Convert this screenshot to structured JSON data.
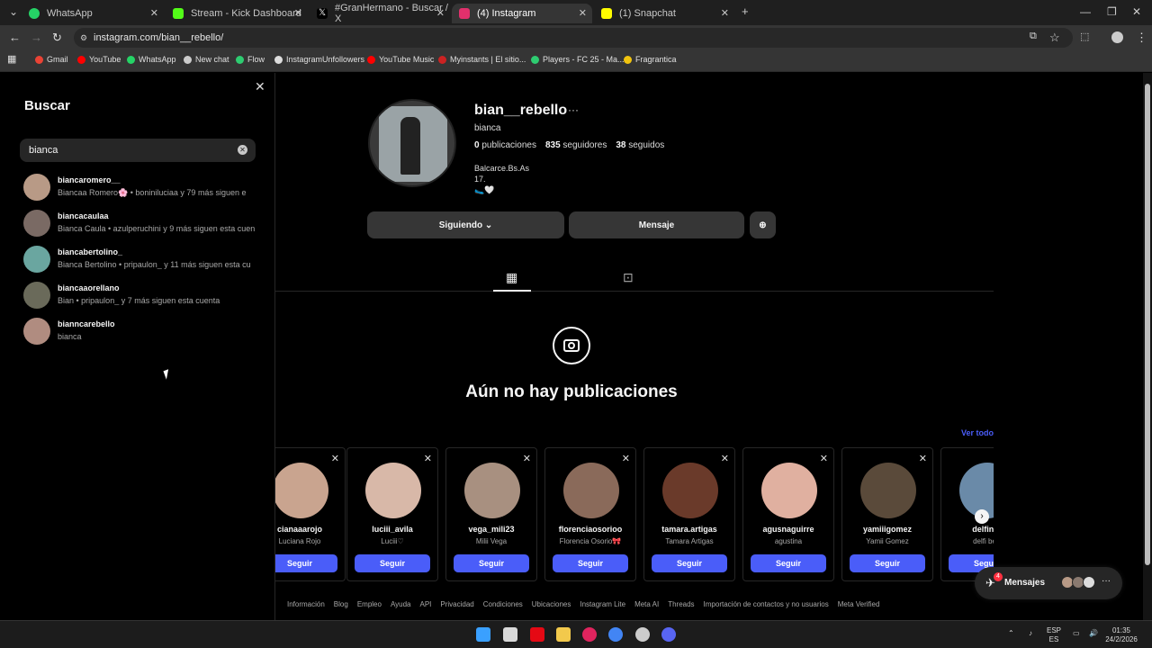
{
  "tabs": [
    {
      "label": "WhatsApp",
      "color": "#25d366"
    },
    {
      "label": "Stream - Kick Dashboard",
      "color": "#53fc18"
    },
    {
      "label": "#GranHermano - Buscar / X",
      "color": "#ffffff"
    },
    {
      "label": "(4) Instagram",
      "color": "#e1306c"
    },
    {
      "label": "(1) Snapchat",
      "color": "#fffc00"
    }
  ],
  "url": "instagram.com/bian__rebello/",
  "bookmarks": [
    {
      "label": "Gmail",
      "color": "#ea4335"
    },
    {
      "label": "YouTube",
      "color": "#ff0000"
    },
    {
      "label": "WhatsApp",
      "color": "#25d366"
    },
    {
      "label": "New chat",
      "color": "#cccccc"
    },
    {
      "label": "Flow",
      "color": "#2ecc71"
    },
    {
      "label": "InstagramUnfollowers",
      "color": "#dddddd"
    },
    {
      "label": "YouTube Music",
      "color": "#ff0000"
    },
    {
      "label": "Myinstants | El sitio...",
      "color": "#cc2222"
    },
    {
      "label": "Players - FC 25 - Ma...",
      "color": "#2ecc71"
    },
    {
      "label": "Fragrantica",
      "color": "#f1c40f"
    }
  ],
  "search": {
    "title": "Buscar",
    "query": "bianca",
    "results": [
      {
        "username": "biancaromero__",
        "sub": "Biancaa Romero🌸 • boniniluciaa y 79 más siguen e",
        "color": "#b89a86"
      },
      {
        "username": "biancacaulaa",
        "sub": "Bianca Caula • azulperuchini y 9 más siguen esta cuen",
        "color": "#7a6a64"
      },
      {
        "username": "biancabertolino_",
        "sub": "Bianca Bertolino • pripaulon_ y 11 más siguen esta cu",
        "color": "#6aa6a0"
      },
      {
        "username": "biancaaorellano",
        "sub": "Bian • pripaulon_ y 7 más siguen esta cuenta",
        "color": "#6a6a5a"
      },
      {
        "username": "bianncarebello",
        "sub": "bianca",
        "color": "#b08c80"
      }
    ]
  },
  "profile": {
    "username": "bian__rebello",
    "more": "···",
    "full_name": "bianca",
    "posts_count": "0",
    "posts_label": "publicaciones",
    "followers_count": "835",
    "followers_label": "seguidores",
    "following_count": "38",
    "following_label": "seguidos",
    "bio_line1": "Balcarce.Bs.As",
    "bio_line2": "17.",
    "bio_line3": "🥿🤍",
    "following_button": "Siguiendo ⌄",
    "message_button": "Mensaje",
    "empty_title": "Aún no hay publicaciones"
  },
  "suggestions": {
    "see_all": "Ver todo",
    "cards": [
      {
        "username": "cianaaarojo",
        "name": "Luciana Rojo",
        "color": "#c9a48f"
      },
      {
        "username": "luciii_avila",
        "name": "Luciii♡",
        "color": "#d8b8a8"
      },
      {
        "username": "vega_mili23",
        "name": "Milii Vega",
        "color": "#a89080"
      },
      {
        "username": "florenciaosorioo",
        "name": "Florencia Osorio🎀",
        "color": "#8a6a5a"
      },
      {
        "username": "tamara.artigas",
        "name": "Tamara Artigas",
        "color": "#6a3a2a"
      },
      {
        "username": "agusnaguirre",
        "name": "agustina",
        "color": "#e0b0a0"
      },
      {
        "username": "yamiiigomez",
        "name": "Yamii Gomez",
        "color": "#5a4a3a"
      },
      {
        "username": "delfinal",
        "name": "delfi bec",
        "color": "#6a8aa8"
      }
    ],
    "follow_label": "Seguir"
  },
  "footer": [
    "Información",
    "Blog",
    "Empleo",
    "Ayuda",
    "API",
    "Privacidad",
    "Condiciones",
    "Ubicaciones",
    "Instagram Lite",
    "Meta AI",
    "Threads",
    "Importación de contactos y no usuarios",
    "Meta Verified"
  ],
  "messages": {
    "label": "Mensajes",
    "badge": "4"
  },
  "taskbar": {
    "lang1": "ESP",
    "lang2": "ES",
    "time": "01:35",
    "date": "24/2/2026"
  }
}
